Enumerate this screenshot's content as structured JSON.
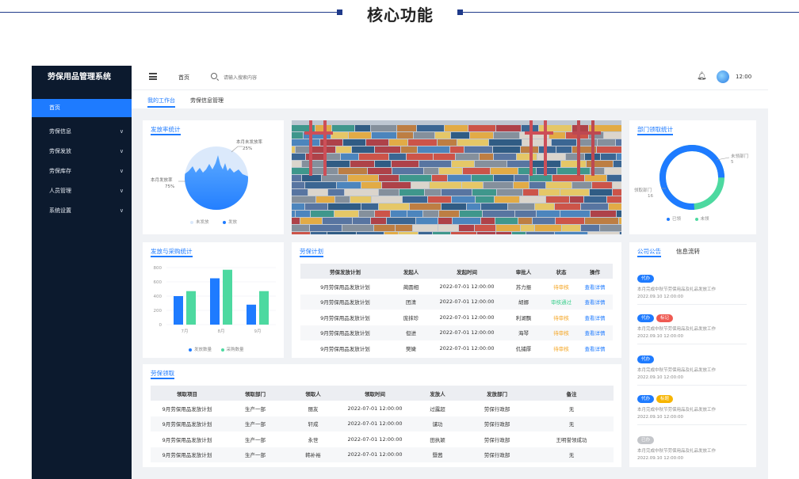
{
  "heading": {
    "title": "核心功能"
  },
  "app": {
    "brand": "劳保用品管理系统",
    "sidebar": {
      "items": [
        {
          "label": "首页",
          "active": true
        },
        {
          "label": "劳保信息",
          "chevron": true
        },
        {
          "label": "劳保发放",
          "chevron": true
        },
        {
          "label": "劳保库存",
          "chevron": true
        },
        {
          "label": "人员管理",
          "chevron": true
        },
        {
          "label": "系统设置",
          "chevron": true
        }
      ]
    },
    "topbar": {
      "home_label": "首页",
      "search_placeholder": "请输入搜索内容",
      "time": "12:00"
    },
    "tabs": [
      {
        "label": "我的工作台",
        "active": true
      },
      {
        "label": "劳保信息管理",
        "active": false
      }
    ]
  },
  "issue_rate": {
    "title": "发放率统计",
    "label_unissued": "本月未发放率",
    "value_unissued": "25%",
    "label_issued": "本月发放率",
    "value_issued": "75%",
    "legend_unissued": "未发放",
    "legend_issued": "发放",
    "colors": {
      "issued": "#1e7bff",
      "unissued": "#dbe9fb"
    }
  },
  "banner": {
    "description": "container-port-photo"
  },
  "dept_pickup": {
    "title": "部门领取统计",
    "label_unpicked": "未领部门",
    "value_unpicked": "5",
    "label_picked": "领取部门",
    "value_picked": "16",
    "legend_picked": "已领",
    "legend_unpicked": "未领",
    "colors": {
      "picked": "#1e7bff",
      "unpicked": "#4dd9a0"
    }
  },
  "chart_data": {
    "type": "bar",
    "title": "发放与采购统计",
    "categories": [
      "7月",
      "8月",
      "9月"
    ],
    "series": [
      {
        "name": "发放数量",
        "values": [
          400,
          650,
          280
        ],
        "color": "#1e7bff"
      },
      {
        "name": "采购数量",
        "values": [
          470,
          770,
          470
        ],
        "color": "#4dd9a0"
      }
    ],
    "yticks": [
      "0",
      "200",
      "400",
      "600",
      "800"
    ],
    "ylim": [
      0,
      800
    ],
    "grid": true,
    "legend_position": "bottom"
  },
  "plan": {
    "title": "劳保计划",
    "columns": [
      "劳保发放计划",
      "发起人",
      "发起时间",
      "审批人",
      "状态",
      "操作"
    ],
    "rows": [
      [
        "9月劳保用品发放计划",
        "蔺圆相",
        "2022-07-01  12:00:00",
        "苏力振",
        "待审核",
        "查看详情"
      ],
      [
        "9月劳保用品发放计划",
        "团清",
        "2022-07-01  12:00:00",
        "胡娜",
        "审核通过",
        "查看详情"
      ],
      [
        "9月劳保用品发放计划",
        "庞抹珍",
        "2022-07-01  12:00:00",
        "利湖飘",
        "待审核",
        "查看详情"
      ],
      [
        "9月劳保用品发放计划",
        "但进",
        "2022-07-01  12:00:00",
        "海琴",
        "待审核",
        "查看详情"
      ],
      [
        "9月劳保用品发放计划",
        "樊婕",
        "2022-07-01  12:00:00",
        "仉捕厚",
        "待审核",
        "查看详情"
      ]
    ],
    "status_colors": {
      "待审核": "#f5a623",
      "审核通过": "#3ccf8e"
    },
    "link_color": "#1e7bff"
  },
  "pickup": {
    "title": "劳保领取",
    "columns": [
      "领取项目",
      "领取部门",
      "领取人",
      "领取时间",
      "发放人",
      "发放部门",
      "备注"
    ],
    "rows": [
      [
        "9月劳保用品发放计划",
        "生产一部",
        "丽友",
        "2022-07-01  12:00:00",
        "过露超",
        "劳保行政部",
        "无"
      ],
      [
        "9月劳保用品发放计划",
        "生产一部",
        "轩成",
        "2022-07-01  12:00:00",
        "谴功",
        "劳保行政部",
        "无"
      ],
      [
        "9月劳保用品发放计划",
        "生产一部",
        "永世",
        "2022-07-01  12:00:00",
        "田执颖",
        "劳保行政部",
        "王明誉领成功"
      ],
      [
        "9月劳保用品发放计划",
        "生产一部",
        "韩补裕",
        "2022-07-01  12:00:00",
        "暨茜",
        "劳保行政部",
        "无"
      ]
    ]
  },
  "notices": {
    "tab_active": "公司公告",
    "tab_other": "信息流转",
    "items": [
      {
        "badges": [
          {
            "text": "代办",
            "color": "#1e7bff"
          }
        ],
        "text": "本月完成中秋节劳保用品及礼品发放工作",
        "date": "2022.09.10  12:00:00"
      },
      {
        "badges": [
          {
            "text": "代办",
            "color": "#1e7bff"
          },
          {
            "text": "标记",
            "color": "#ef5a52"
          }
        ],
        "text": "本月完成中秋节劳保用品及礼品发放工作",
        "date": "2022.09.10  12:00:00"
      },
      {
        "badges": [
          {
            "text": "代办",
            "color": "#1e7bff"
          }
        ],
        "text": "本月完成中秋节劳保用品及礼品发放工作",
        "date": "2022.09.10  12:00:00"
      },
      {
        "badges": [
          {
            "text": "代办",
            "color": "#1e7bff"
          },
          {
            "text": "标题",
            "color": "#f7b500"
          }
        ],
        "text": "本月完成中秋节劳保用品及礼品发放工作",
        "date": "2022.09.10  12:00:00"
      },
      {
        "badges": [
          {
            "text": "已办",
            "color": "#c4c6ca"
          }
        ],
        "text": "本月完成中秋节劳保用品及礼品发放工作",
        "date": "2022.09.10  12:00:00"
      }
    ]
  }
}
